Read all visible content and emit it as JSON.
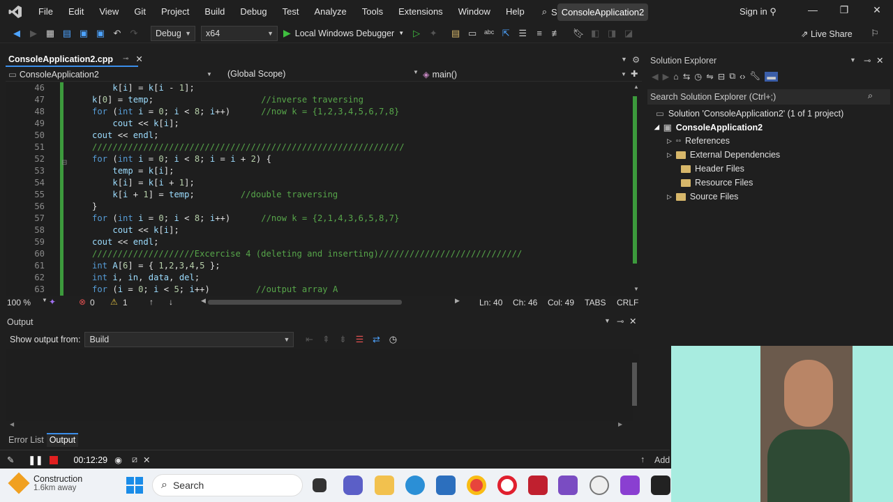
{
  "menubar": {
    "items": [
      "File",
      "Edit",
      "View",
      "Git",
      "Project",
      "Build",
      "Debug",
      "Test",
      "Analyze",
      "Tools",
      "Extensions",
      "Window",
      "Help"
    ],
    "search_label": "Search",
    "solution_name": "ConsoleApplication2",
    "sign_in": "Sign in"
  },
  "toolbar": {
    "config": "Debug",
    "platform": "x64",
    "debugger": "Local Windows Debugger",
    "live_share": "Live Share"
  },
  "editor": {
    "tab_title": "ConsoleApplication2.cpp",
    "project_dropdown": "ConsoleApplication2",
    "scope_dropdown": "(Global Scope)",
    "function_dropdown": "main()",
    "lines": [
      {
        "n": "46",
        "t": "    k[i] = k[i - 1];"
      },
      {
        "n": "47",
        "t": "k[0] = temp;                     //inverse traversing"
      },
      {
        "n": "48",
        "t": "for (int i = 0; i < 8; i++)      //now k = {1,2,3,4,5,6,7,8}"
      },
      {
        "n": "49",
        "t": "    cout << k[i];"
      },
      {
        "n": "50",
        "t": "cout << endl;"
      },
      {
        "n": "51",
        "t": "/////////////////////////////////////////////////////////////"
      },
      {
        "n": "52",
        "t": "for (int i = 0; i < 8; i = i + 2) {"
      },
      {
        "n": "53",
        "t": "    temp = k[i];"
      },
      {
        "n": "54",
        "t": "    k[i] = k[i + 1];"
      },
      {
        "n": "55",
        "t": "    k[i + 1] = temp;         //double traversing"
      },
      {
        "n": "56",
        "t": "}"
      },
      {
        "n": "57",
        "t": "for (int i = 0; i < 8; i++)      //now k = {2,1,4,3,6,5,8,7}"
      },
      {
        "n": "58",
        "t": "    cout << k[i];"
      },
      {
        "n": "59",
        "t": "cout << endl;"
      },
      {
        "n": "60",
        "t": "////////////////////Excercise 4 (deleting and inserting)////////////////////////////"
      },
      {
        "n": "61",
        "t": "int A[6] = { 1,2,3,4,5 };"
      },
      {
        "n": "62",
        "t": "int i, in, data, del;"
      },
      {
        "n": "63",
        "t": "for (i = 0; i < 5; i++)         //output array A"
      }
    ],
    "zoom": "100 %",
    "errors": "0",
    "warnings": "1",
    "ln": "Ln: 40",
    "ch": "Ch: 46",
    "col": "Col: 49",
    "tabs": "TABS",
    "eol": "CRLF"
  },
  "output": {
    "title": "Output",
    "show_from_label": "Show output from:",
    "source": "Build"
  },
  "bottom_tabs": [
    "Error List",
    "Output"
  ],
  "solution_explorer": {
    "title": "Solution Explorer",
    "search_placeholder": "Search Solution Explorer (Ctrl+;)",
    "solution": "Solution 'ConsoleApplication2' (1 of 1 project)",
    "project": "ConsoleApplication2",
    "items": [
      "References",
      "External Dependencies",
      "Header Files",
      "Resource Files",
      "Source Files"
    ]
  },
  "recorder": {
    "time": "00:12:29",
    "add_label": "Add"
  },
  "taskbar": {
    "weather_title": "Construction",
    "weather_sub": "1.6km away",
    "search": "Search"
  },
  "colors": {
    "accent": "#3b8eea",
    "change_bar": "#3c9a3c",
    "keyword": "#569cd6",
    "comment": "#57a64a",
    "ident": "#9cdcfe"
  }
}
